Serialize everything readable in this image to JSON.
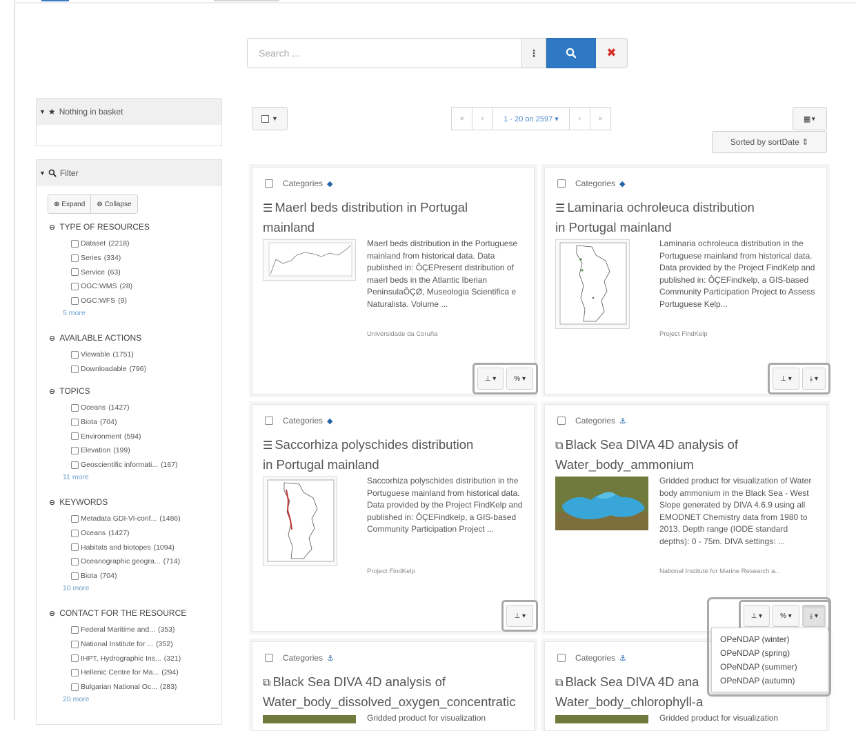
{
  "search": {
    "placeholder": "Search ..."
  },
  "basket": {
    "label": "Nothing in basket"
  },
  "filter": {
    "label": "Filter",
    "expand_label": "Expand",
    "collapse_label": "Collapse",
    "facets": [
      {
        "title": "TYPE OF RESOURCES",
        "items": [
          {
            "label": "Dataset",
            "count": "(2218)"
          },
          {
            "label": "Series",
            "count": "(334)"
          },
          {
            "label": "Service",
            "count": "(63)"
          },
          {
            "label": "OGC:WMS",
            "count": "(28)"
          },
          {
            "label": "OGC:WFS",
            "count": "(9)"
          }
        ],
        "more": "5  more"
      },
      {
        "title": "AVAILABLE ACTIONS",
        "items": [
          {
            "label": "Viewable",
            "count": "(1751)"
          },
          {
            "label": "Downloadable",
            "count": "(796)"
          }
        ]
      },
      {
        "title": "TOPICS",
        "items": [
          {
            "label": "Oceans",
            "count": "(1427)"
          },
          {
            "label": "Biota",
            "count": "(704)"
          },
          {
            "label": "Environment",
            "count": "(594)"
          },
          {
            "label": "Elevation",
            "count": "(199)"
          },
          {
            "label": "Geoscientific informati...",
            "count": "(167)"
          }
        ],
        "more": "11  more"
      },
      {
        "title": "KEYWORDS",
        "items": [
          {
            "label": "Metadata GDI-Vl-conf...",
            "count": "(1486)"
          },
          {
            "label": "Oceans",
            "count": "(1427)"
          },
          {
            "label": "Habitats and biotopes",
            "count": "(1094)"
          },
          {
            "label": "Oceanographic geogra...",
            "count": "(714)"
          },
          {
            "label": "Biota",
            "count": "(704)"
          }
        ],
        "more": "10  more"
      },
      {
        "title": "CONTACT FOR THE RESOURCE",
        "items": [
          {
            "label": "Federal Maritime and...",
            "count": "(353)"
          },
          {
            "label": "National Institute for ...",
            "count": "(352)"
          },
          {
            "label": "IHPT, Hydrographic Ins...",
            "count": "(321)"
          },
          {
            "label": "Hellenic Centre for Ma...",
            "count": "(294)"
          },
          {
            "label": "Bulgarian National Oc...",
            "count": "(283)"
          }
        ],
        "more": "20  more"
      }
    ]
  },
  "pagination": {
    "range": "1 - 20 on 2597 ▾"
  },
  "sort": {
    "label": "Sorted by sortDate ⇕"
  },
  "cards": [
    {
      "categories": "Categories",
      "title_line1": "Maerl beds distribution in Portugal",
      "title_line2": "mainland",
      "abstract": "Maerl beds distribution in the Portuguese mainland from historical data. Data published in: ÔÇEPresent distribution of maerl beds in the Atlantic Iberian PeninsulaÔÇØ, Museologia Scientifica e Naturalista. Volume ...",
      "source": "Universidade da Coruña"
    },
    {
      "categories": "Categories",
      "title_line1": "Laminaria ochroleuca distribution",
      "title_line2": "in Portugal mainland",
      "abstract": "Laminaria ochroleuca distribution in the Portuguese mainland from historical data. Data provided by the Project FindKelp and published in: ÔÇEFindkelp, a GIS-based Community Participation Project to Assess Portuguese Kelp...",
      "source": "Project FindKelp"
    },
    {
      "categories": "Categories",
      "title_line1": "Saccorhiza polyschides distribution",
      "title_line2": "in Portugal mainland",
      "abstract": "Saccorhiza polyschides distribution in the Portuguese mainland from historical data. Data provided by the Project FindKelp and published in: ÔÇEFindkelp, a GIS-based Community Participation Project ...",
      "source": "Project FindKelp"
    },
    {
      "categories": "Categories",
      "title_line1": "Black Sea DIVA 4D analysis of",
      "title_line2": "Water_body_ammonium",
      "abstract": "Gridded product for visualization of Water body ammonium in the Black Sea - West Slope generated by DIVA 4.6.9 using all EMODNET Chemistry data from 1980 to 2013. Depth range (IODE standard depths): 0 - 75m. DIVA settings: ...",
      "source": "National Institute for Marine Research a..."
    },
    {
      "categories": "Categories",
      "title_line1": "Black Sea DIVA 4D analysis of",
      "title_line2": "Water_body_dissolved_oxygen_concentratic",
      "abstract": "Gridded product for visualization",
      "source": ""
    },
    {
      "categories": "Categories",
      "title_line1": "Black Sea DIVA 4D ana",
      "title_line2": "Water_body_chlorophyll-a",
      "abstract": "Gridded product for visualization",
      "source": ""
    }
  ],
  "dropdown": {
    "items": [
      "OPeNDAP (winter)",
      "OPeNDAP (spring)",
      "OPeNDAP (summer)",
      "OPeNDAP (autumn)"
    ]
  },
  "colors": {
    "primary": "#2f78c4",
    "danger": "#d9322b",
    "link": "#4a8acb"
  },
  "icons": {
    "basket": "star-icon",
    "filter": "search-icon",
    "more": "ellipsis-vertical-icon",
    "search": "search-icon",
    "clear": "close-icon",
    "category_layer": "layer-icon",
    "category_anchor": "anchor-icon",
    "dataset": "database-icon",
    "service": "copy-icon",
    "pin": "pin-icon",
    "link": "link-icon",
    "download": "download-icon",
    "grid": "grid-icon"
  }
}
